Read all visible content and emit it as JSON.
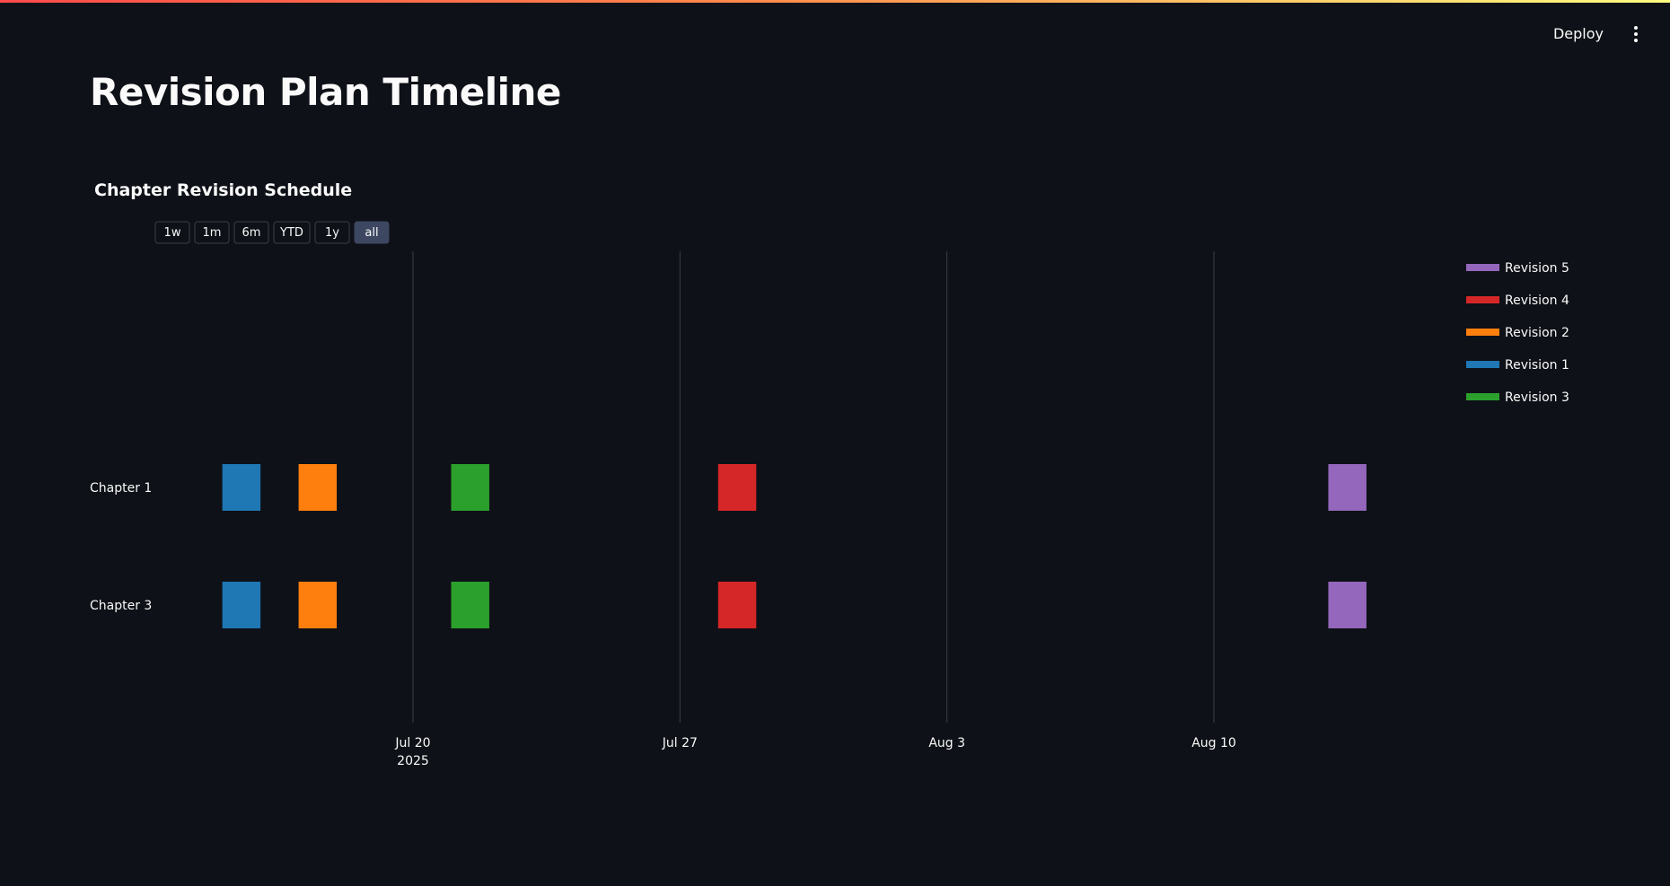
{
  "app": {
    "deploy_label": "Deploy",
    "menu_icon": "kebab-icon"
  },
  "page": {
    "title": "Revision Plan Timeline"
  },
  "range_buttons": [
    {
      "label": "1w",
      "active": false
    },
    {
      "label": "1m",
      "active": false
    },
    {
      "label": "6m",
      "active": false
    },
    {
      "label": "YTD",
      "active": false
    },
    {
      "label": "1y",
      "active": false
    },
    {
      "label": "all",
      "active": true
    }
  ],
  "colors": {
    "background": "#0e1117",
    "gridline": "#3a3f4b",
    "text": "#fafafa"
  },
  "chart_data": {
    "type": "timeline",
    "title": "Chapter Revision Schedule",
    "categories": [
      "Chapter 1",
      "Chapter 3"
    ],
    "x_axis": {
      "type": "date",
      "range": [
        "2025-07-12",
        "2025-08-19"
      ],
      "ticks": [
        {
          "date": "2025-07-20",
          "label": "Jul 20",
          "sublabel": "2025"
        },
        {
          "date": "2025-07-27",
          "label": "Jul 27",
          "sublabel": ""
        },
        {
          "date": "2025-08-03",
          "label": "Aug 3",
          "sublabel": ""
        },
        {
          "date": "2025-08-10",
          "label": "Aug 10",
          "sublabel": ""
        }
      ],
      "grid": true
    },
    "legend": {
      "position": "top-right",
      "order": [
        "Revision 5",
        "Revision 4",
        "Revision 2",
        "Revision 1",
        "Revision 3"
      ]
    },
    "series": [
      {
        "name": "Revision 1",
        "color": "#1f77b4",
        "segments": [
          {
            "category": "Chapter 1",
            "start": "2025-07-15",
            "end": "2025-07-16"
          },
          {
            "category": "Chapter 3",
            "start": "2025-07-15",
            "end": "2025-07-16"
          }
        ]
      },
      {
        "name": "Revision 2",
        "color": "#ff7f0e",
        "segments": [
          {
            "category": "Chapter 1",
            "start": "2025-07-17",
            "end": "2025-07-18"
          },
          {
            "category": "Chapter 3",
            "start": "2025-07-17",
            "end": "2025-07-18"
          }
        ]
      },
      {
        "name": "Revision 3",
        "color": "#2ca02c",
        "segments": [
          {
            "category": "Chapter 1",
            "start": "2025-07-21",
            "end": "2025-07-22"
          },
          {
            "category": "Chapter 3",
            "start": "2025-07-21",
            "end": "2025-07-22"
          }
        ]
      },
      {
        "name": "Revision 4",
        "color": "#d62728",
        "segments": [
          {
            "category": "Chapter 1",
            "start": "2025-07-28",
            "end": "2025-07-29"
          },
          {
            "category": "Chapter 3",
            "start": "2025-07-28",
            "end": "2025-07-29"
          }
        ]
      },
      {
        "name": "Revision 5",
        "color": "#9467bd",
        "segments": [
          {
            "category": "Chapter 1",
            "start": "2025-08-13",
            "end": "2025-08-14"
          },
          {
            "category": "Chapter 3",
            "start": "2025-08-13",
            "end": "2025-08-14"
          }
        ]
      }
    ]
  }
}
